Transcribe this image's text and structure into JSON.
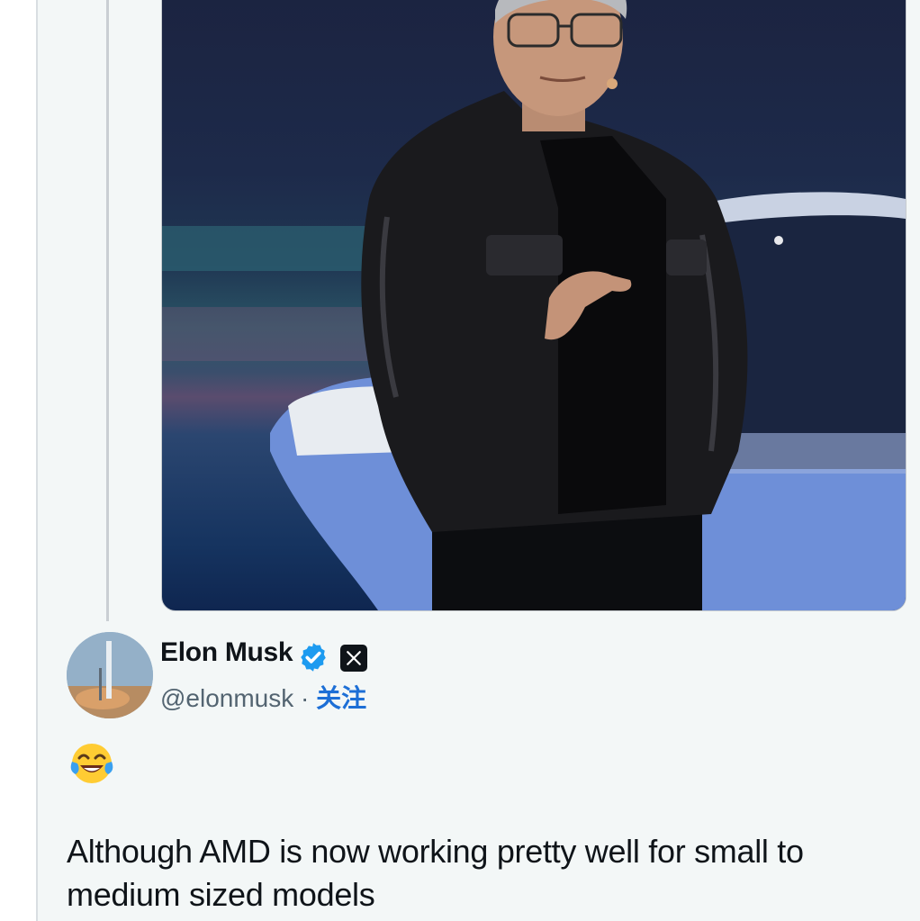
{
  "reply_tweet": {
    "author": {
      "display_name": "Elon Musk",
      "handle": "@elonmusk",
      "separator": " · ",
      "follow_label": "关注",
      "verified_badge_icon": "verified-checkmark-icon",
      "affiliate_badge_icon": "x-logo-icon"
    },
    "emoji": "face-with-tears-of-joy",
    "text": "Although AMD is now working pretty well for small to medium sized models"
  },
  "colors": {
    "verified_blue": "#1d9bf0",
    "follow_blue": "#1d6fd6",
    "text_primary": "#0f1419",
    "text_secondary": "#536471",
    "card_background": "#f3f7f7"
  }
}
